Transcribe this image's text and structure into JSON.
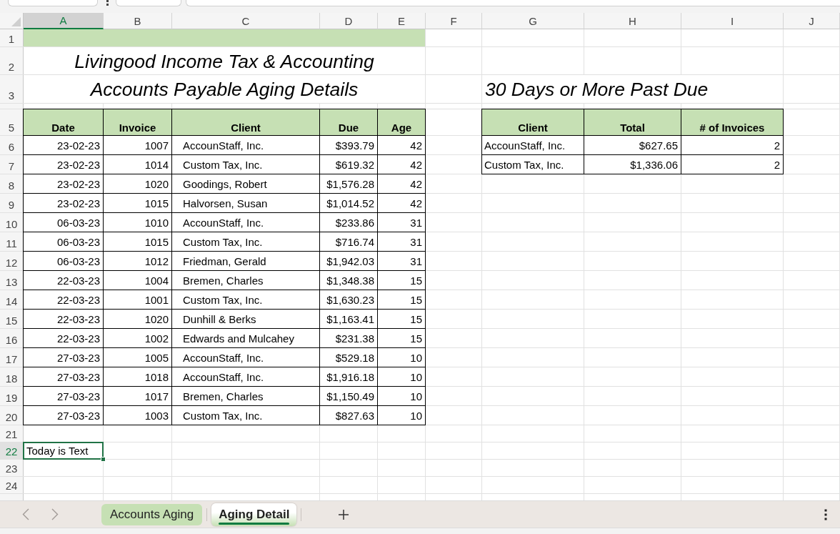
{
  "column_headers": [
    {
      "label": "A",
      "selected": true
    },
    {
      "label": "B",
      "selected": false
    },
    {
      "label": "C",
      "selected": false
    },
    {
      "label": "D",
      "selected": false
    },
    {
      "label": "E",
      "selected": false
    },
    {
      "label": "F",
      "selected": false
    },
    {
      "label": "G",
      "selected": false
    },
    {
      "label": "H",
      "selected": false
    },
    {
      "label": "I",
      "selected": false
    },
    {
      "label": "J",
      "selected": false
    }
  ],
  "row_headers": [
    {
      "label": "1",
      "selected": false
    },
    {
      "label": "2",
      "selected": false
    },
    {
      "label": "3",
      "selected": false
    },
    {
      "label": "5",
      "selected": false
    },
    {
      "label": "6",
      "selected": false
    },
    {
      "label": "7",
      "selected": false
    },
    {
      "label": "8",
      "selected": false
    },
    {
      "label": "9",
      "selected": false
    },
    {
      "label": "10",
      "selected": false
    },
    {
      "label": "11",
      "selected": false
    },
    {
      "label": "12",
      "selected": false
    },
    {
      "label": "13",
      "selected": false
    },
    {
      "label": "14",
      "selected": false
    },
    {
      "label": "15",
      "selected": false
    },
    {
      "label": "16",
      "selected": false
    },
    {
      "label": "17",
      "selected": false
    },
    {
      "label": "18",
      "selected": false
    },
    {
      "label": "19",
      "selected": false
    },
    {
      "label": "20",
      "selected": false
    },
    {
      "label": "21",
      "selected": false
    },
    {
      "label": "22",
      "selected": true
    },
    {
      "label": "23",
      "selected": false
    },
    {
      "label": "24",
      "selected": false
    }
  ],
  "title": "Livingood Income Tax & Accounting",
  "subtitle": "Accounts Payable Aging Details",
  "aging_table": {
    "columns": [
      "Date",
      "Invoice",
      "Client",
      "Due",
      "Age"
    ],
    "rows": [
      [
        "23-02-23",
        "1007",
        "AccounStaff, Inc.",
        "$393.79",
        "42"
      ],
      [
        "23-02-23",
        "1014",
        "Custom Tax, Inc.",
        "$619.32",
        "42"
      ],
      [
        "23-02-23",
        "1020",
        "Goodings, Robert",
        "$1,576.28",
        "42"
      ],
      [
        "23-02-23",
        "1015",
        "Halvorsen, Susan",
        "$1,014.52",
        "42"
      ],
      [
        "06-03-23",
        "1010",
        "AccounStaff, Inc.",
        "$233.86",
        "31"
      ],
      [
        "06-03-23",
        "1015",
        "Custom Tax, Inc.",
        "$716.74",
        "31"
      ],
      [
        "06-03-23",
        "1012",
        "Friedman, Gerald",
        "$1,942.03",
        "31"
      ],
      [
        "22-03-23",
        "1004",
        "Bremen, Charles",
        "$1,348.38",
        "15"
      ],
      [
        "22-03-23",
        "1001",
        "Custom Tax, Inc.",
        "$1,630.23",
        "15"
      ],
      [
        "22-03-23",
        "1020",
        "Dunhill & Berks",
        "$1,163.41",
        "15"
      ],
      [
        "22-03-23",
        "1002",
        "Edwards and Mulcahey",
        "$231.38",
        "15"
      ],
      [
        "27-03-23",
        "1005",
        "AccounStaff, Inc.",
        "$529.18",
        "10"
      ],
      [
        "27-03-23",
        "1018",
        "AccounStaff, Inc.",
        "$1,916.18",
        "10"
      ],
      [
        "27-03-23",
        "1017",
        "Bremen, Charles",
        "$1,150.49",
        "10"
      ],
      [
        "27-03-23",
        "1003",
        "Custom Tax, Inc.",
        "$827.63",
        "10"
      ]
    ]
  },
  "summary_title": "30 Days or More Past Due",
  "summary_table": {
    "columns": [
      "Client",
      "Total",
      "# of Invoices"
    ],
    "rows": [
      [
        "AccounStaff, Inc.",
        "$627.65",
        "2"
      ],
      [
        "Custom Tax, Inc.",
        "$1,336.06",
        "2"
      ]
    ]
  },
  "note_cell": {
    "value": "Today is Text",
    "selected": true
  },
  "sheet_tabs": [
    {
      "label": "Accounts Aging",
      "selected": false
    },
    {
      "label": "Aging Detail",
      "selected": true
    }
  ]
}
